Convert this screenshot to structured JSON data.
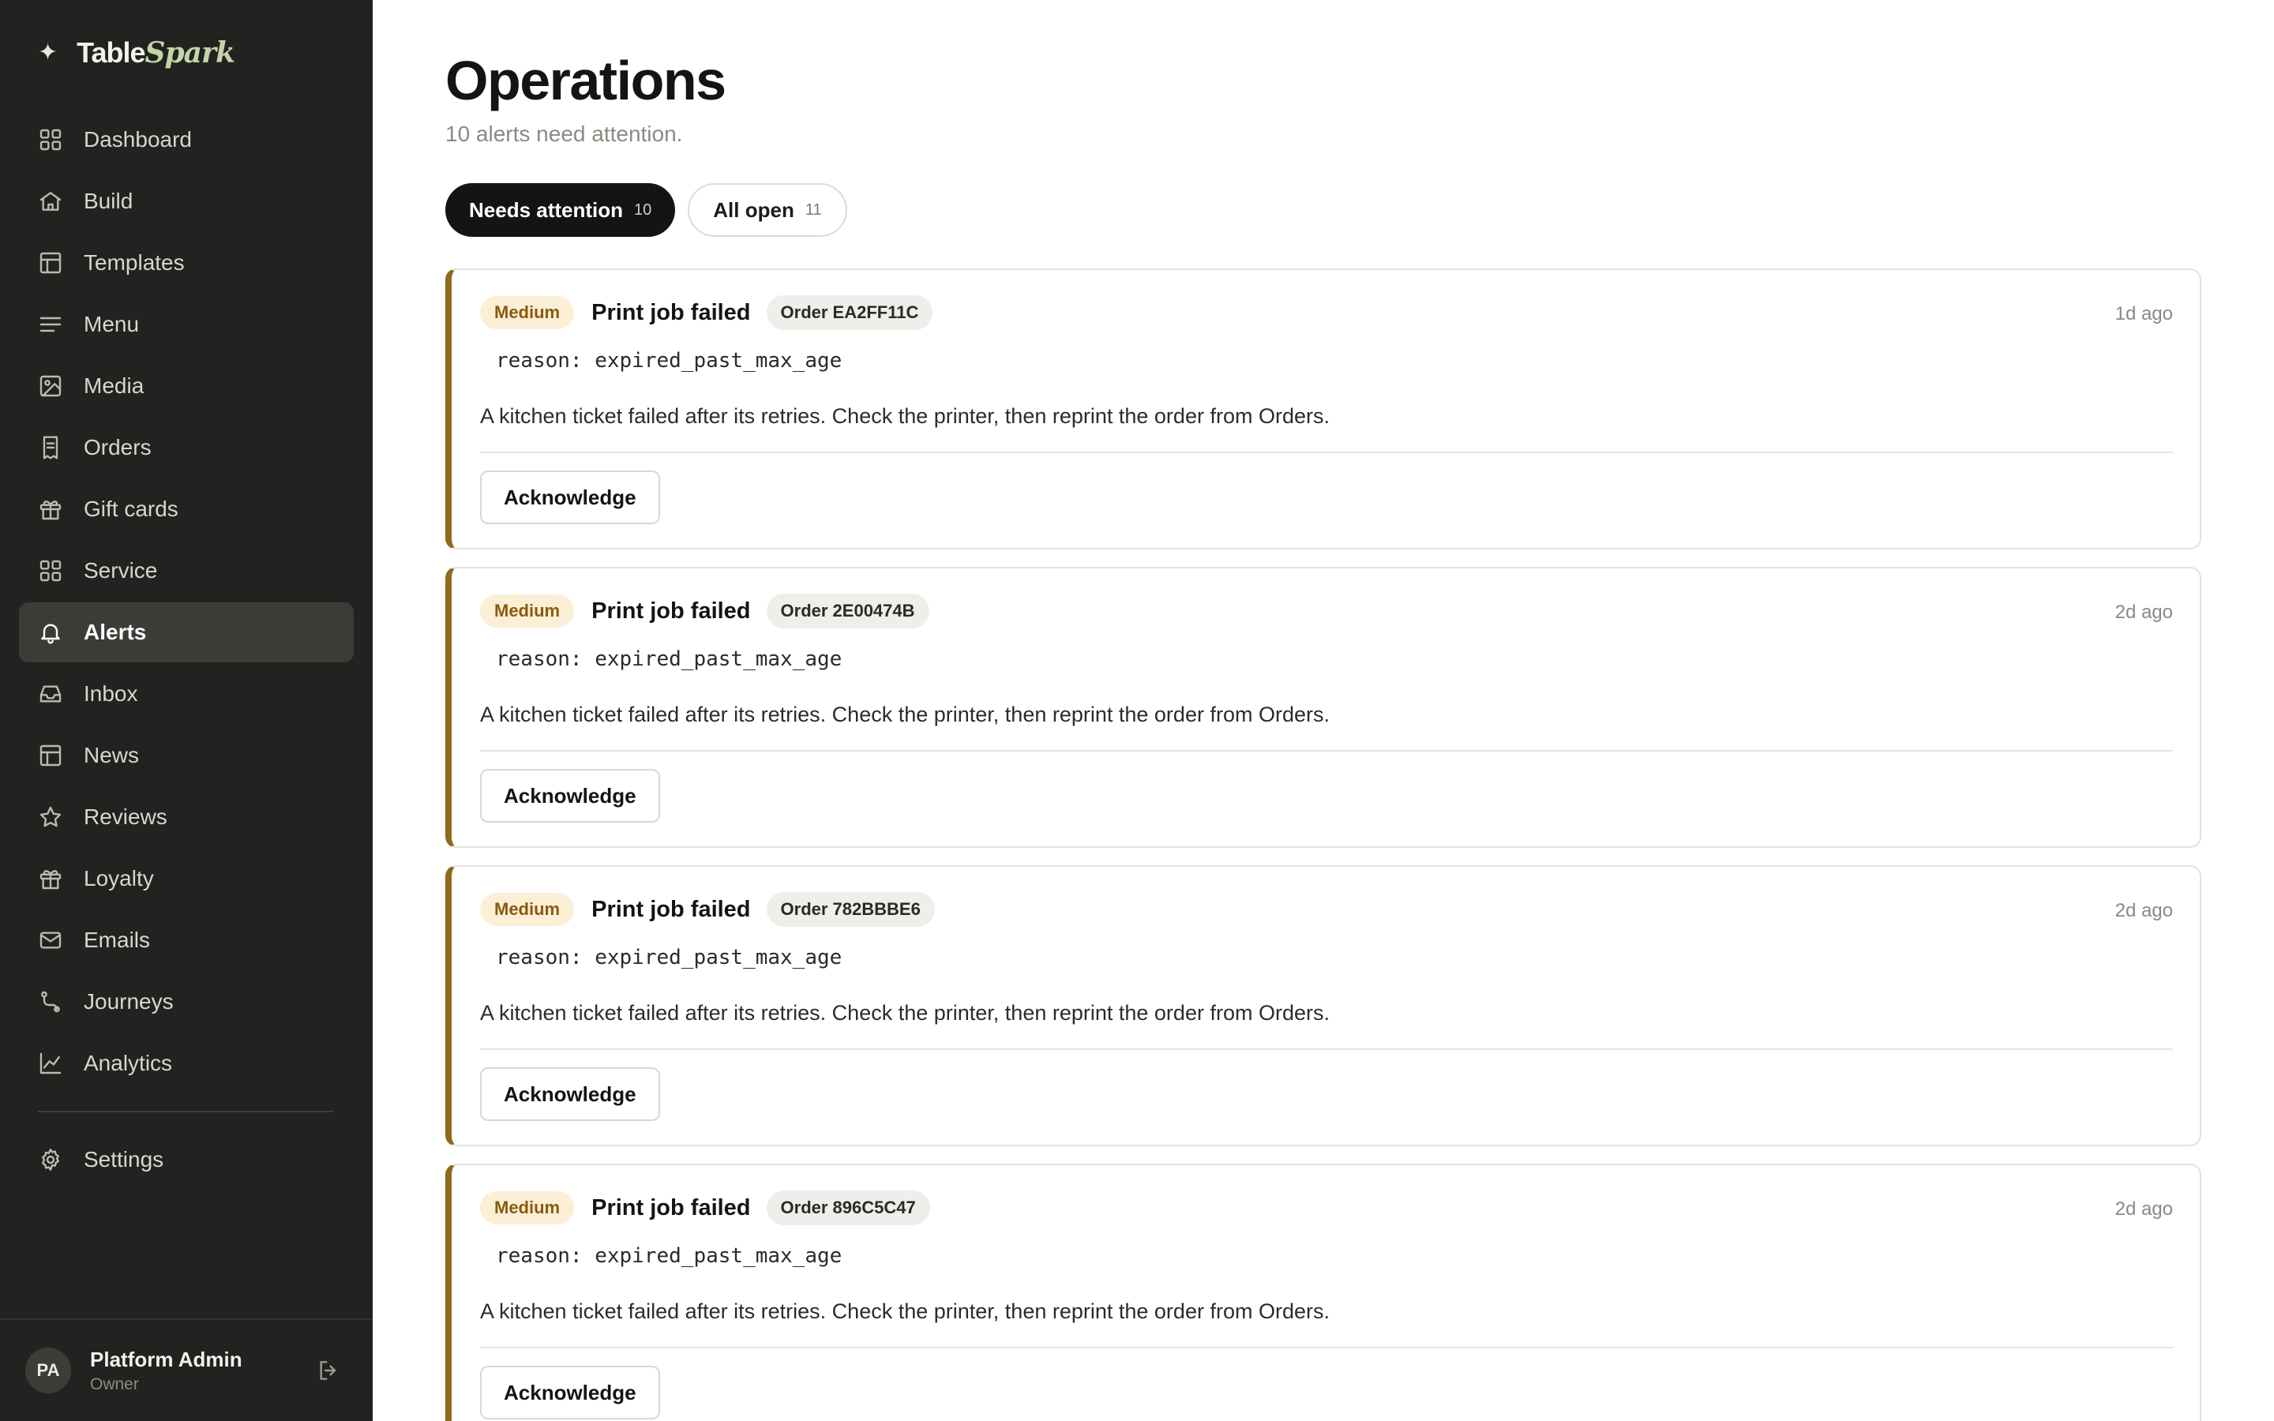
{
  "brand": {
    "mark": "✦",
    "name_primary": "Table",
    "name_accent": "Spark"
  },
  "sidebar": {
    "items": [
      {
        "label": "Dashboard",
        "icon": "grid-icon"
      },
      {
        "label": "Build",
        "icon": "home-icon"
      },
      {
        "label": "Templates",
        "icon": "layout-icon"
      },
      {
        "label": "Menu",
        "icon": "lines-icon"
      },
      {
        "label": "Media",
        "icon": "image-icon"
      },
      {
        "label": "Orders",
        "icon": "receipt-icon"
      },
      {
        "label": "Gift cards",
        "icon": "gift-icon"
      },
      {
        "label": "Service",
        "icon": "grid-icon"
      },
      {
        "label": "Alerts",
        "icon": "bell-icon",
        "active": true
      },
      {
        "label": "Inbox",
        "icon": "inbox-icon"
      },
      {
        "label": "News",
        "icon": "layout-icon"
      },
      {
        "label": "Reviews",
        "icon": "star-icon"
      },
      {
        "label": "Loyalty",
        "icon": "gift-icon"
      },
      {
        "label": "Emails",
        "icon": "mail-icon"
      },
      {
        "label": "Journeys",
        "icon": "route-icon"
      },
      {
        "label": "Analytics",
        "icon": "chart-line-icon"
      }
    ],
    "settings": {
      "label": "Settings",
      "icon": "gear-icon"
    }
  },
  "user": {
    "initials": "PA",
    "name": "Platform Admin",
    "role": "Owner",
    "logout_icon": "logout-icon"
  },
  "page": {
    "title": "Operations",
    "subtitle": "10 alerts need attention."
  },
  "tabs": [
    {
      "label": "Needs attention",
      "count": "10",
      "active": true
    },
    {
      "label": "All open",
      "count": "11",
      "active": false
    }
  ],
  "alerts": [
    {
      "severity": "Medium",
      "title": "Print job failed",
      "order": "Order EA2FF11C",
      "time": "1d ago",
      "reason": "reason: expired_past_max_age",
      "description": "A kitchen ticket failed after its retries. Check the printer, then reprint the order from Orders.",
      "action": "Acknowledge"
    },
    {
      "severity": "Medium",
      "title": "Print job failed",
      "order": "Order 2E00474B",
      "time": "2d ago",
      "reason": "reason: expired_past_max_age",
      "description": "A kitchen ticket failed after its retries. Check the printer, then reprint the order from Orders.",
      "action": "Acknowledge"
    },
    {
      "severity": "Medium",
      "title": "Print job failed",
      "order": "Order 782BBBE6",
      "time": "2d ago",
      "reason": "reason: expired_past_max_age",
      "description": "A kitchen ticket failed after its retries. Check the printer, then reprint the order from Orders.",
      "action": "Acknowledge"
    },
    {
      "severity": "Medium",
      "title": "Print job failed",
      "order": "Order 896C5C47",
      "time": "2d ago",
      "reason": "reason: expired_past_max_age",
      "description": "A kitchen ticket failed after its retries. Check the printer, then reprint the order from Orders.",
      "action": "Acknowledge"
    }
  ],
  "colors": {
    "sidebar_bg": "#222220",
    "active_nav_bg": "#3b3b38",
    "alert_accent": "#8f6a1c",
    "severity_bg": "#fbefd6",
    "brand_accent": "#c5d3a6"
  }
}
